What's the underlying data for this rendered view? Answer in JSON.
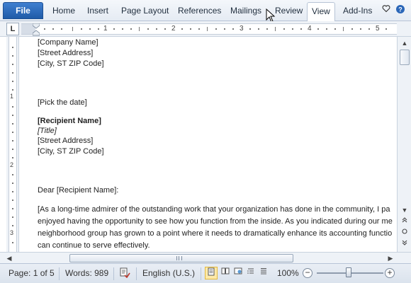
{
  "ribbon": {
    "file": "File",
    "tabs": [
      "Home",
      "Insert",
      "Page Layout",
      "References",
      "Mailings",
      "Review",
      "View",
      "Add-Ins"
    ],
    "active_tab": "View"
  },
  "ruler": {
    "toggle": "L",
    "numbers": [
      "1",
      "2",
      "3",
      "4",
      "5"
    ],
    "vertical_numbers": [
      "1",
      "2",
      "3"
    ]
  },
  "document": {
    "lines": [
      {
        "text": "[Company Name]",
        "style": "normal"
      },
      {
        "text": "[Street Address]",
        "style": "normal"
      },
      {
        "text": "[City, ST ZIP Code]",
        "style": "normal"
      },
      {
        "text": "[Pick the date]",
        "style": "normal"
      },
      {
        "text": "[Recipient Name]",
        "style": "bold"
      },
      {
        "text": "[Title]",
        "style": "italic"
      },
      {
        "text": "[Street Address]",
        "style": "normal"
      },
      {
        "text": "[City, ST ZIP Code]",
        "style": "normal"
      },
      {
        "text": "Dear [Recipient Name]:",
        "style": "normal"
      },
      {
        "text": "[As a long-time admirer of the outstanding work that your organization has done in the community, I pa",
        "style": "normal"
      },
      {
        "text": "enjoyed having the opportunity to see how you function from the inside. As you indicated during our me",
        "style": "normal"
      },
      {
        "text": "neighborhood group has grown to a point where it needs to dramatically enhance its accounting functio",
        "style": "normal"
      },
      {
        "text": "can continue to serve effectively.",
        "style": "normal"
      }
    ]
  },
  "status_bar": {
    "page": "Page: 1 of 5",
    "words": "Words: 989",
    "language": "English (U.S.)",
    "zoom": "100%",
    "zoom_level_percent": 100
  }
}
